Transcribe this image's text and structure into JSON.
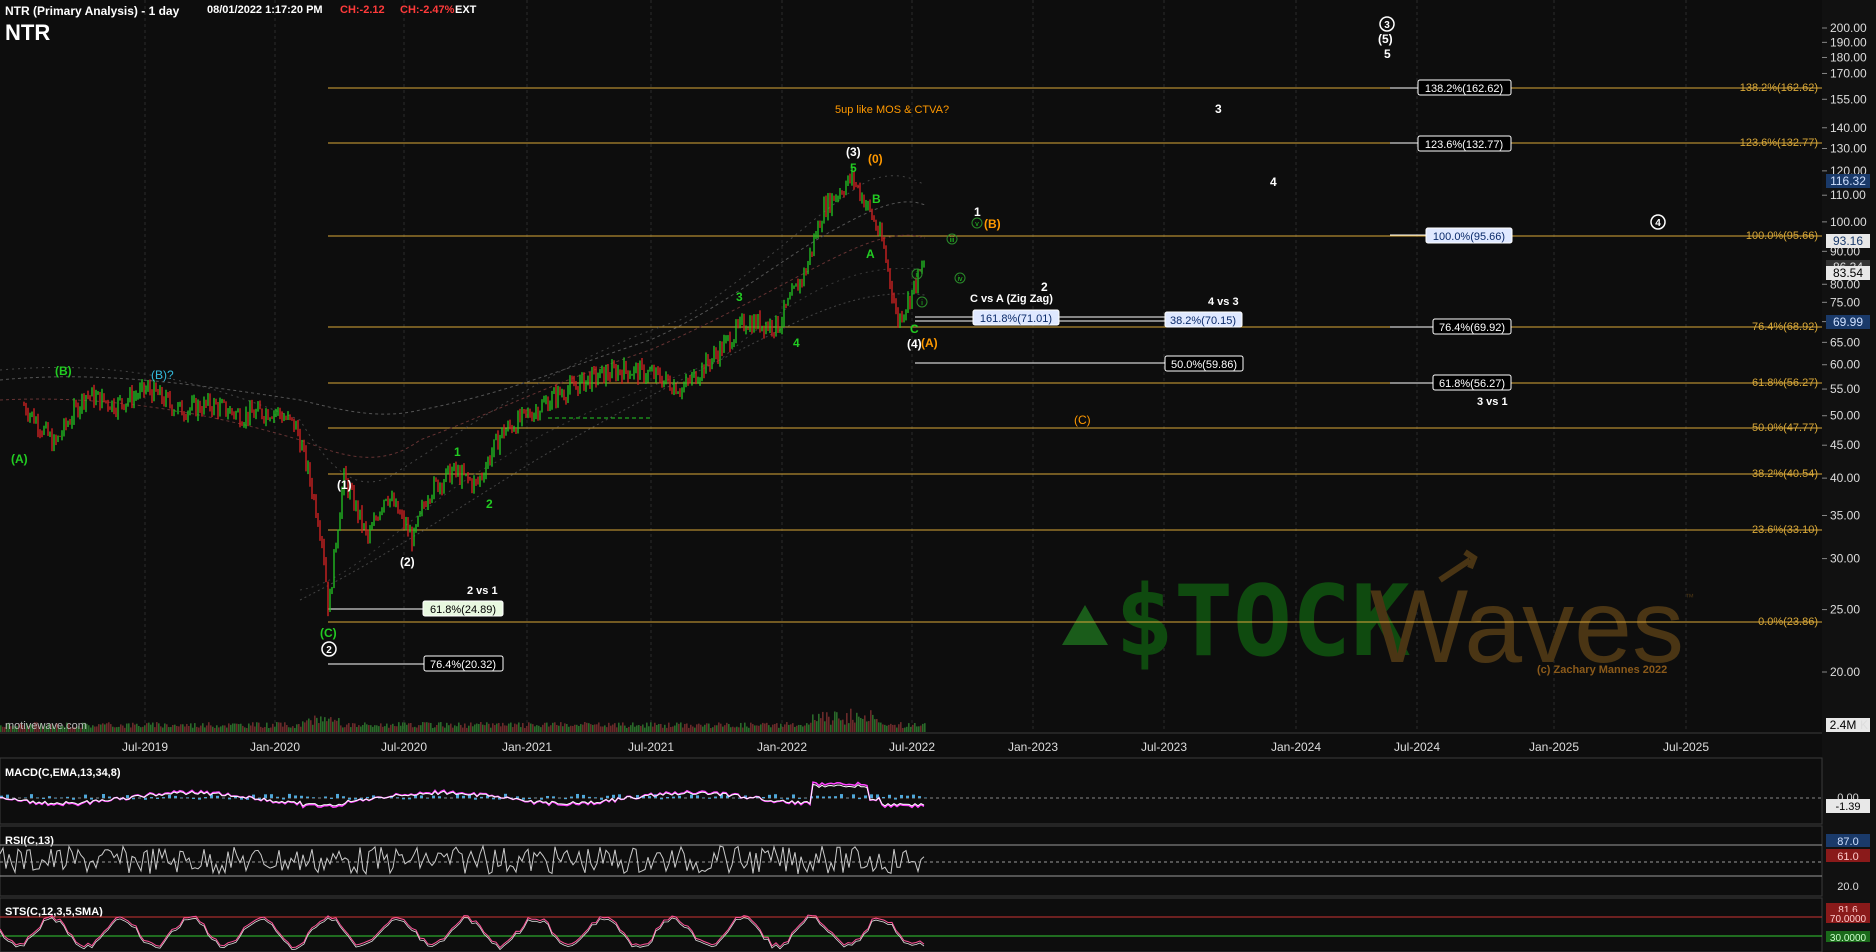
{
  "header": {
    "symbol": "NTR",
    "title": "NTR (Primary Analysis) - 1 day",
    "timestamp": "08/01/2022 1:17:20 PM",
    "change": "CH:-2.12",
    "change_pct": "CH:-2.47%",
    "ext": "EXT"
  },
  "colors": {
    "background": "#0d0d0d",
    "fib_line": "#d9a838",
    "fib_text": "#d9a838",
    "wave_green": "#22cc22",
    "wave_orange": "#ff9900",
    "wave_cyan": "#33bbdd",
    "wave_white": "#ffffff",
    "macd_line": "#ff44ff",
    "histogram": "#4fa7d8",
    "stoch_line": "#ff5599",
    "price_up": "#22bb22",
    "price_down": "#cc2222"
  },
  "watermark": {
    "part1": "$TOCK",
    "part2": "Waves",
    "tm": "™",
    "copyright": "(c) Zachary Mannes 2022",
    "source": "motivewave.com"
  },
  "price_axis": {
    "ticks": [
      "200.00",
      "190.00",
      "180.00",
      "170.00",
      "155.00",
      "140.00",
      "130.00",
      "120.00",
      "110.00",
      "100.00",
      "90.00",
      "80.00",
      "75.00",
      "70.00",
      "65.00",
      "60.00",
      "55.00",
      "50.00",
      "45.00",
      "40.00",
      "35.00",
      "30.00",
      "25.00",
      "20.00"
    ],
    "volume_label": "2.4M",
    "volume_k": "K",
    "badges": [
      {
        "label": "116.32",
        "bg": "#1a3a6a",
        "fg": "#cfe0ff"
      },
      {
        "label": "93.16",
        "bg": "#e8e8e8",
        "fg": "#1a3a6a"
      },
      {
        "label": "86.34",
        "bg": "#333",
        "fg": "#ddd"
      },
      {
        "label": "83.54",
        "bg": "#e8e8e8",
        "fg": "#000"
      },
      {
        "label": "69.99",
        "bg": "#1a3a6a",
        "fg": "#cfe0ff"
      }
    ]
  },
  "time_axis": {
    "labels": [
      "Jul-2019",
      "Jan-2020",
      "Jul-2020",
      "Jan-2021",
      "Jul-2021",
      "Jan-2022",
      "Jul-2022",
      "Jan-2023",
      "Jul-2023",
      "Jan-2024",
      "Jul-2024",
      "Jan-2025",
      "Jul-2025"
    ]
  },
  "fib_right": [
    "138.2%(162.62)",
    "123.6%(132.77)",
    "100.0%(95.66)",
    "76.4%(68.92)",
    "61.8%(56.27)",
    "50.0%(47.77)",
    "38.2%(40.54)",
    "23.6%(33.10)",
    "0.0%(23.86)"
  ],
  "fib_mid": [
    "138.2%(162.62)",
    "123.6%(132.77)",
    "100.0%(95.66)",
    "76.4%(69.92)",
    "61.8%(56.27)"
  ],
  "fib_boxes": {
    "b1618": "161.8%(71.01)",
    "b382": "38.2%(70.15)",
    "b500": "50.0%(59.86)",
    "b618_low": "61.8%(24.89)",
    "b764_low": "76.4%(20.32)"
  },
  "annotations": {
    "five_up": "5up like MOS & CTVA?",
    "c_vs_a": "C vs A (Zig Zag)",
    "four_vs_3": "4 vs 3",
    "three_vs_1": "3 vs 1",
    "two_vs_1": "2 vs 1"
  },
  "wave_labels": {
    "A_green": "(A)",
    "B_green": "(B)",
    "B_cyan": "(B)?",
    "C_green": "(C)",
    "circle2": "2",
    "w1": "(1)",
    "w2": "(2)",
    "g1": "1",
    "g2": "2",
    "g3": "3",
    "g4": "4",
    "g5": "5",
    "w3": "(3)",
    "o0": "(0)",
    "gA": "A",
    "gB": "B",
    "gC": "C",
    "w4": "(4)",
    "oA": "(A)",
    "oB": "(B)",
    "oC": "(C)",
    "p1": "1",
    "p2": "2",
    "p3": "3",
    "p4": "4",
    "p5": "5",
    "c3": "3",
    "p5paren": "(5)",
    "c4": "4",
    "ci": "i",
    "cii": "ii",
    "ciii": "iii",
    "civ": "iv",
    "cv": "v"
  },
  "indicators": {
    "macd": {
      "label": "MACD(C,EMA,13,34,8)",
      "value1": "0.00",
      "value2": "-1.39"
    },
    "rsi": {
      "label": "RSI(C,13)",
      "v87": "87.0",
      "v61": "61.0",
      "v20": "20.0"
    },
    "stoch": {
      "label": "STS(C,12,3,5,SMA)",
      "v1": "81.6",
      "v70": "70.0000",
      "v30": "30.0000"
    }
  },
  "chart_data": {
    "type": "line",
    "title": "NTR (Primary Analysis) - 1 day",
    "xlabel": "",
    "ylabel": "",
    "scale": "log",
    "ylim": [
      18,
      215
    ],
    "x": [
      "2019-01-01",
      "2019-02-15",
      "2019-04-01",
      "2019-05-15",
      "2019-07-01",
      "2019-08-15",
      "2019-10-01",
      "2019-11-15",
      "2020-01-01",
      "2020-02-01",
      "2020-03-10",
      "2020-03-19",
      "2020-04-10",
      "2020-05-15",
      "2020-06-10",
      "2020-07-20",
      "2020-08-10",
      "2020-09-15",
      "2020-10-20",
      "2020-11-25",
      "2021-01-01",
      "2021-02-15",
      "2021-04-01",
      "2021-05-20",
      "2021-07-01",
      "2021-08-15",
      "2021-10-01",
      "2021-11-15",
      "2022-01-01",
      "2022-02-10",
      "2022-03-08",
      "2022-04-18",
      "2022-05-10",
      "2022-06-01",
      "2022-06-23",
      "2022-07-10",
      "2022-08-01"
    ],
    "series": [
      {
        "values": [
          52,
          45,
          54,
          52,
          55,
          51,
          52,
          50,
          51,
          48,
          32,
          24.6,
          40,
          32,
          38,
          32,
          38,
          41,
          39,
          47,
          50,
          54,
          57,
          59,
          58,
          55,
          62,
          70,
          69,
          84,
          105,
          117,
          106,
          93,
          70,
          76,
          86
        ]
      }
    ],
    "fib_levels": [
      {
        "label": "138.2%",
        "value": 162.62
      },
      {
        "label": "123.6%",
        "value": 132.77
      },
      {
        "label": "100.0%",
        "value": 95.66
      },
      {
        "label": "76.4%",
        "value": 68.92
      },
      {
        "label": "61.8%",
        "value": 56.27
      },
      {
        "label": "50.0%",
        "value": 47.77
      },
      {
        "label": "38.2%",
        "value": 40.54
      },
      {
        "label": "23.6%",
        "value": 33.1
      },
      {
        "label": "0.0%",
        "value": 23.86
      }
    ],
    "last_price": 86.34
  }
}
